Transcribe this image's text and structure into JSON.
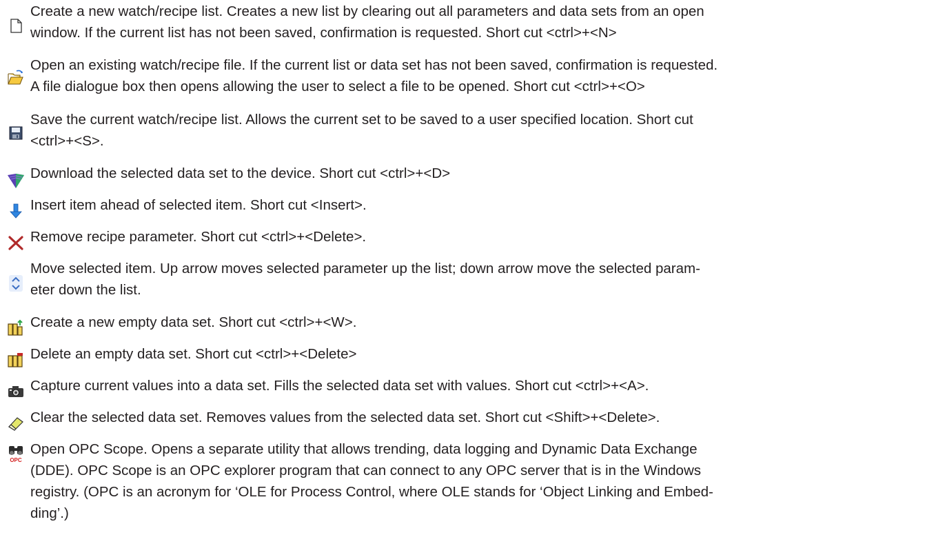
{
  "entries": [
    {
      "icon": "new-document-icon",
      "text": "Create a new watch/recipe list.  Creates a new list by clearing out all parameters and data sets from an open\nwindow.  If the current list has not been saved, confirmation is requested.  Short cut <ctrl>+<N>"
    },
    {
      "icon": "open-folder-icon",
      "text": "Open an existing watch/recipe file.  If the current list or data set has not been saved, confirmation is requested.\nA file dialogue box then opens allowing the user to select a file to be opened.  Short cut <ctrl>+<O>"
    },
    {
      "icon": "save-disk-icon",
      "text": "Save the current watch/recipe list.  Allows the current set to be saved to a user specified location.  Short cut\n<ctrl>+<S>."
    },
    {
      "icon": "download-icon",
      "text": "Download the selected data set to the device. Short cut <ctrl>+<D>"
    },
    {
      "icon": "insert-arrow-icon",
      "text": "Insert item ahead of selected item.  Short cut <Insert>."
    },
    {
      "icon": "remove-x-icon",
      "text": "Remove recipe parameter.  Short cut <ctrl>+<Delete>."
    },
    {
      "icon": "move-up-down-icon",
      "text": "Move selected item.  Up arrow moves selected parameter up the list; down arrow move the selected param-\neter down the list."
    },
    {
      "icon": "new-data-set-icon",
      "text": "Create a new empty data set.  Short cut <ctrl>+<W>."
    },
    {
      "icon": "delete-data-set-icon",
      "text": "Delete an empty data set.  Short cut <ctrl>+<Delete>"
    },
    {
      "icon": "capture-camera-icon",
      "text": "Capture current values into a data set. Fills the selected data set with values. Short cut <ctrl>+<A>."
    },
    {
      "icon": "eraser-icon",
      "text": "Clear the selected data set.  Removes values from the selected data set.  Short cut <Shift>+<Delete>."
    },
    {
      "icon": "opc-scope-binoculars-icon",
      "icon_label": "OPC",
      "text": "Open OPC Scope.  Opens a separate utility that allows trending, data logging and Dynamic Data Exchange\n(DDE).  OPC Scope is an OPC explorer program that can connect to any OPC server that is in the Windows\nregistry. (OPC is an acronym for ‘OLE for Process Control, where OLE stands for ‘Object Linking and Embed-\nding’.)"
    }
  ]
}
